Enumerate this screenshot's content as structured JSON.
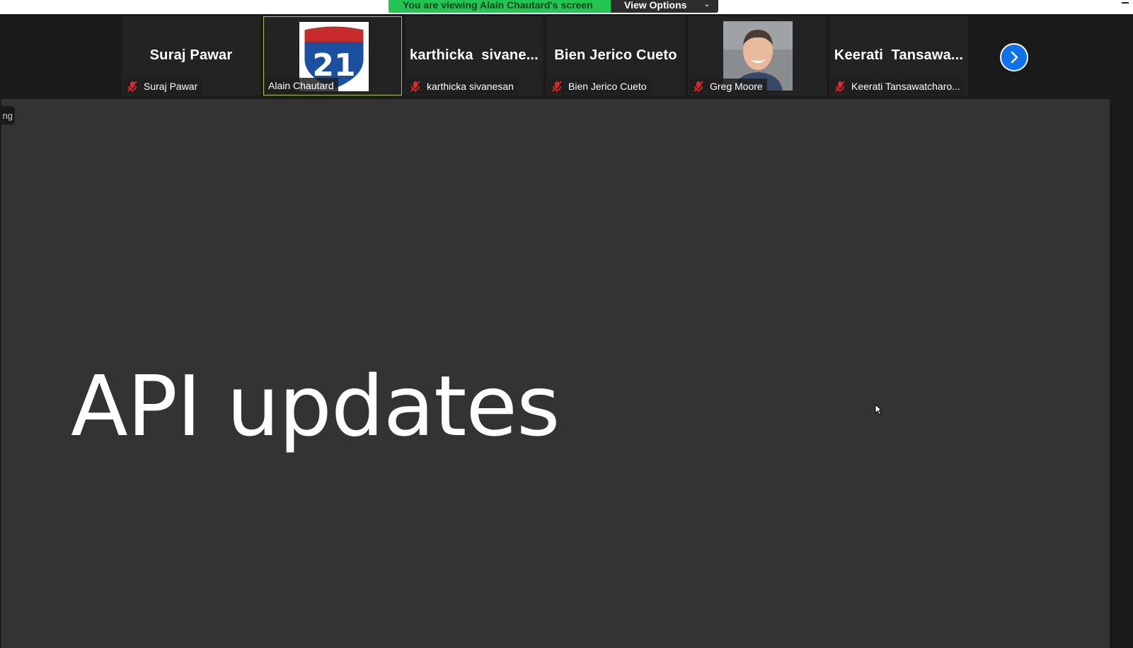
{
  "banner": {
    "message": "You are viewing Alain Chautard's screen",
    "view_options": "View Options",
    "colors": {
      "message_bg": "#23c552",
      "options_bg": "#2d2d2d"
    }
  },
  "participants": [
    {
      "display": "Suraj Pawar",
      "label": "Suraj Pawar",
      "muted": true,
      "active": false
    },
    {
      "display": "",
      "label": "Alain Chautard",
      "muted": false,
      "active": true,
      "avatar": "interstate-21-shield"
    },
    {
      "display": "karthicka  sivane...",
      "label": "karthicka sivanesan",
      "muted": true,
      "active": false
    },
    {
      "display": "Bien Jerico Cueto",
      "label": "Bien Jerico Cueto",
      "muted": true,
      "active": false
    },
    {
      "display": "",
      "label": "Greg Moore",
      "muted": true,
      "active": false,
      "avatar": "person-photo"
    },
    {
      "display": "Keerati  Tansawa...",
      "label": "Keerati Tansawatcharo...",
      "muted": true,
      "active": false
    }
  ],
  "shield": {
    "number": "21"
  },
  "side_tab": {
    "text": "ng"
  },
  "slide": {
    "title": "API updates"
  },
  "icons": {
    "next": "chevron-right-icon",
    "mute": "muted-mic-icon"
  },
  "accent": "#0e72ed",
  "active_border": "#a9c93d"
}
